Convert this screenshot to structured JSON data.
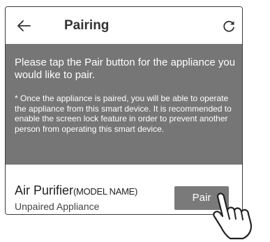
{
  "header": {
    "title": "Pairing",
    "back_icon": "arrow-left-icon",
    "refresh_icon": "refresh-icon"
  },
  "info": {
    "message": "Please tap the Pair button for the appliance you would like to pair.",
    "note": "* Once the appliance is paired, you will be able to operate the appliance from this smart device. It is recommended to enable the screen lock feature in order to prevent another person from operating this smart device."
  },
  "device": {
    "name": "Air Purifier",
    "model_label": "(MODEL NAME)",
    "status": "Unpaired Appliance",
    "pair_label": "Pair"
  },
  "colors": {
    "info_background": "#767676",
    "button_background": "#7a7a7a",
    "text_dark": "#333333"
  }
}
